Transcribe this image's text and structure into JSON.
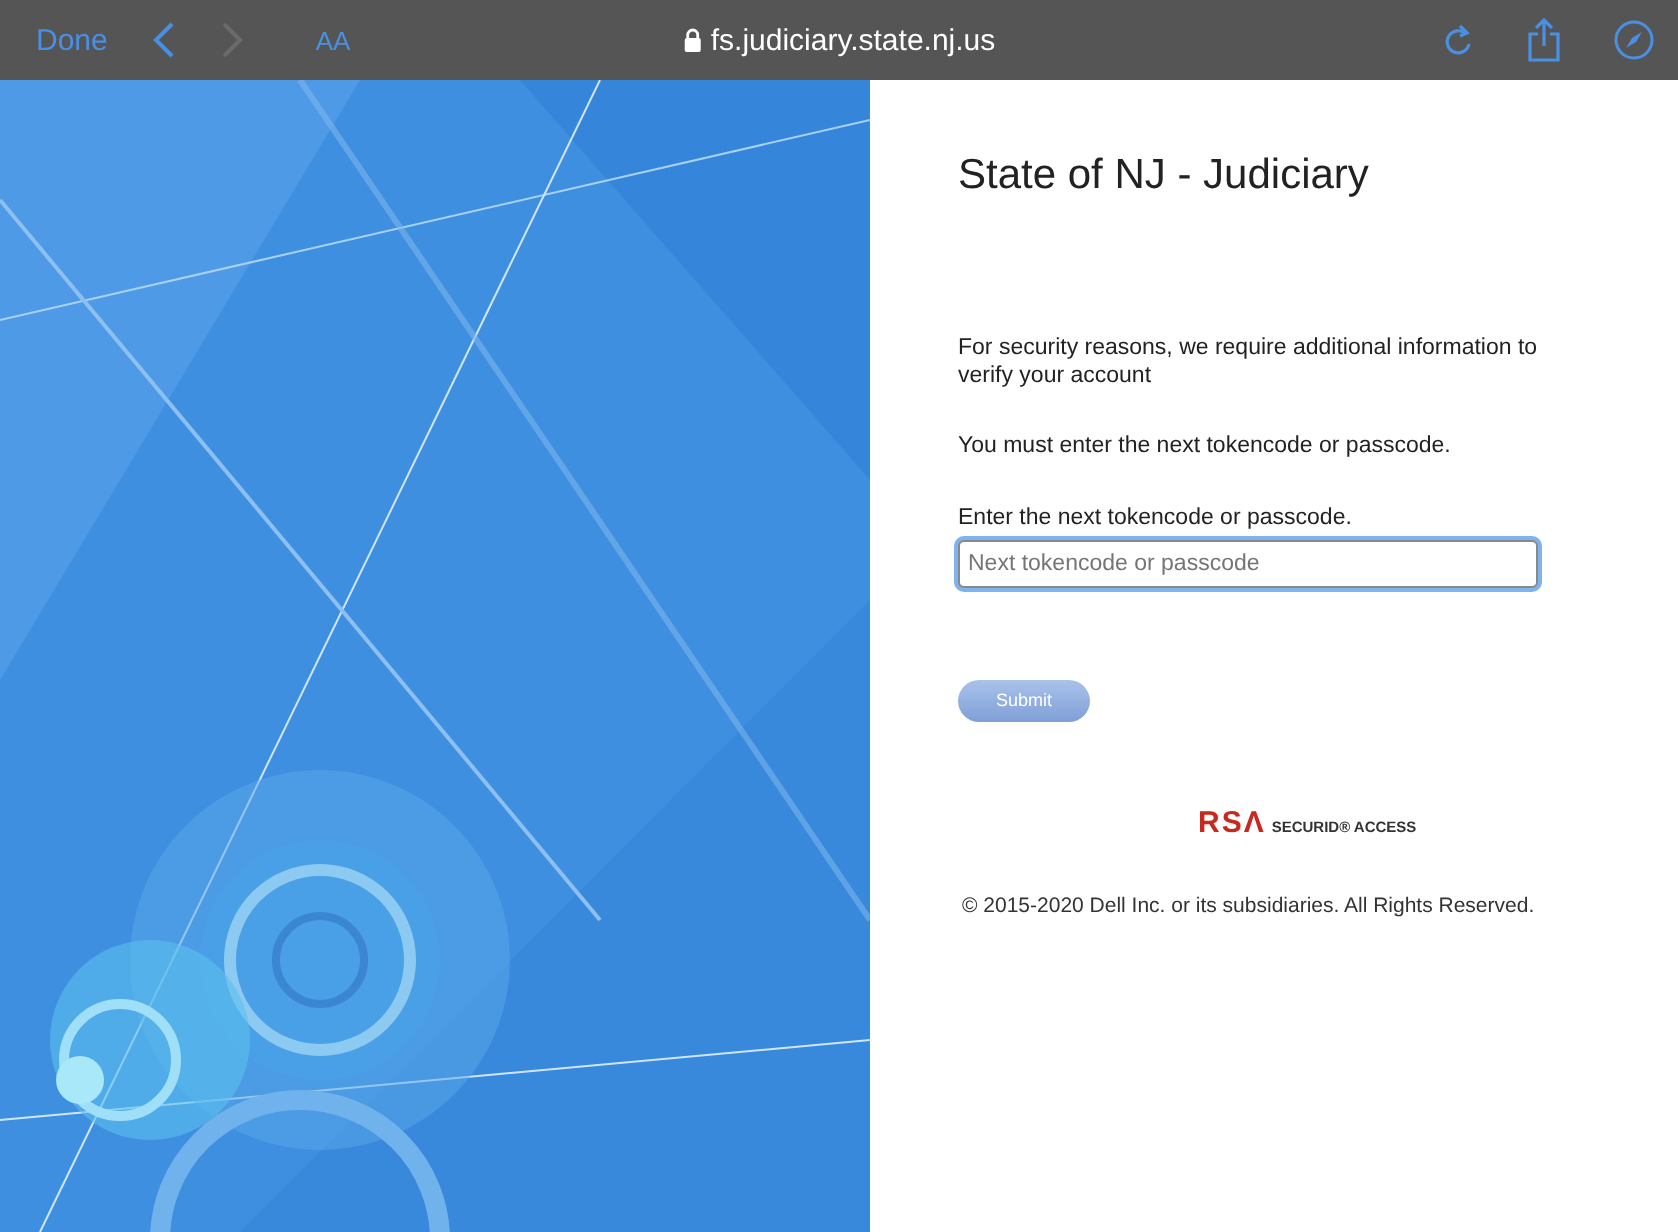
{
  "browser_bar": {
    "done": "Done",
    "text_size": "AA",
    "url": "fs.judiciary.state.nj.us",
    "back_disabled": false,
    "forward_disabled": true
  },
  "form": {
    "title": "State of NJ - Judiciary",
    "intro": "For security reasons, we require additional information to verify your account",
    "instruction": "You must enter the next tokencode or passcode.",
    "field_label": "Enter the next tokencode or passcode.",
    "field": {
      "placeholder": "Next tokencode or passcode",
      "focused": true
    },
    "submit": {
      "label": "Submit",
      "disabled": true
    },
    "logo": {
      "brand": "RSΛ",
      "product": "SECURID® ACCESS"
    },
    "copyright": "© 2015-2020 Dell Inc. or its subsidiaries. All Rights Reserved."
  }
}
